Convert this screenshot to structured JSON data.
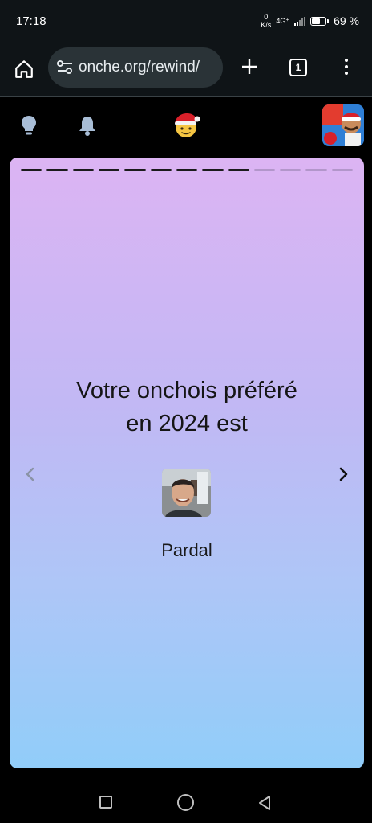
{
  "status_bar": {
    "time": "17:18",
    "net_speed_value": "0",
    "net_speed_unit": "K/s",
    "network_type": "4G⁺",
    "battery_percent": "69 %",
    "battery_level": 0.69
  },
  "browser": {
    "url": "onche.org/rewind/",
    "tab_count": "1",
    "icons": {
      "home": "home-icon",
      "site_settings": "tune-icon",
      "new_tab": "plus-icon",
      "tabs": "tab-switcher-icon",
      "menu": "more-vert-icon"
    }
  },
  "site_header": {
    "icons": {
      "left1": "lightbulb-icon",
      "left2": "bell-icon",
      "center": "santa-emoji-logo",
      "right": "profile-avatar"
    }
  },
  "story": {
    "progress_total": 13,
    "progress_done": 9,
    "heading_line1": "Votre onchois préféré",
    "heading_line2": "en 2024 est",
    "favorite_name": "Pardal",
    "icons": {
      "prev": "chevron-left-icon",
      "next": "chevron-right-icon"
    },
    "colors": {
      "gradient_top": "#dcb4f3",
      "gradient_bottom": "#91cdf9"
    }
  },
  "nav_bar": {
    "icons": [
      "recents-square-icon",
      "home-circle-icon",
      "back-triangle-icon"
    ]
  }
}
